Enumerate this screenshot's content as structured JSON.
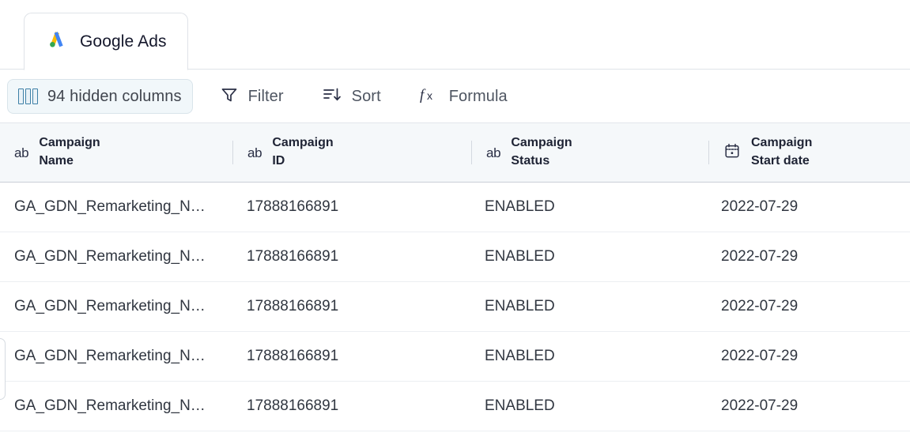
{
  "tab": {
    "label": "Google Ads",
    "icon": "google-ads-logo"
  },
  "toolbar": {
    "hidden_columns_label": "94 hidden columns",
    "hidden_columns_icon": "columns-icon",
    "filter_label": "Filter",
    "filter_icon": "funnel-icon",
    "sort_label": "Sort",
    "sort_icon": "sort-descending-icon",
    "formula_label": "Formula",
    "formula_icon": "function-icon"
  },
  "grid": {
    "columns": [
      {
        "line1": "Campaign",
        "line2": "Name",
        "type_icon": "text-type-icon",
        "type_glyph": "ab"
      },
      {
        "line1": "Campaign",
        "line2": "ID",
        "type_icon": "text-type-icon",
        "type_glyph": "ab"
      },
      {
        "line1": "Campaign",
        "line2": "Status",
        "type_icon": "text-type-icon",
        "type_glyph": "ab"
      },
      {
        "line1": "Campaign",
        "line2": "Start date",
        "type_icon": "calendar-type-icon",
        "type_glyph": ""
      }
    ],
    "rows": [
      {
        "name": "GA_GDN_Remarketing_N…",
        "id": "17888166891",
        "status": "ENABLED",
        "start_date": "2022-07-29"
      },
      {
        "name": "GA_GDN_Remarketing_N…",
        "id": "17888166891",
        "status": "ENABLED",
        "start_date": "2022-07-29"
      },
      {
        "name": "GA_GDN_Remarketing_N…",
        "id": "17888166891",
        "status": "ENABLED",
        "start_date": "2022-07-29"
      },
      {
        "name": "GA_GDN_Remarketing_N…",
        "id": "17888166891",
        "status": "ENABLED",
        "start_date": "2022-07-29"
      },
      {
        "name": "GA_GDN_Remarketing_N…",
        "id": "17888166891",
        "status": "ENABLED",
        "start_date": "2022-07-29"
      }
    ]
  },
  "colors": {
    "header_bg": "#f5f8fa",
    "accent_blue": "#3d7fa6",
    "text_primary": "#1e2334",
    "text_secondary": "#4e5561",
    "google_blue": "#4285f4",
    "google_yellow": "#fbbc04",
    "google_green": "#34a853"
  }
}
